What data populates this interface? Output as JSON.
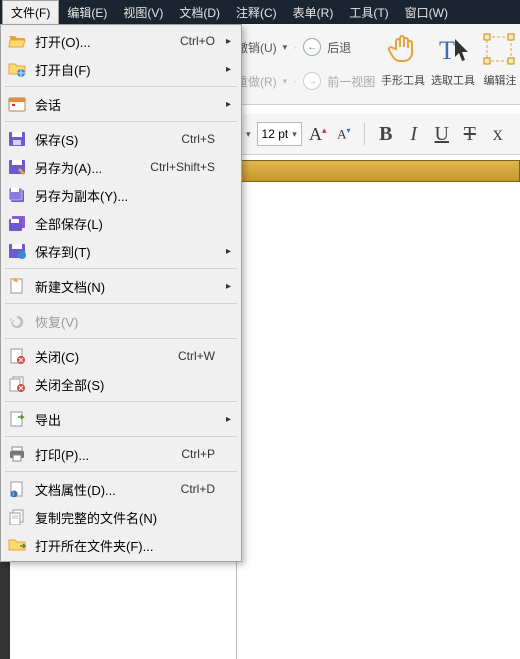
{
  "menubar": {
    "items": [
      {
        "label": "文件(F)",
        "active": true
      },
      {
        "label": "编辑(E)"
      },
      {
        "label": "视图(V)"
      },
      {
        "label": "文档(D)"
      },
      {
        "label": "注释(C)"
      },
      {
        "label": "表单(R)"
      },
      {
        "label": "工具(T)"
      },
      {
        "label": "窗口(W)"
      }
    ]
  },
  "ribbon": {
    "undo_label": "撤销(U)",
    "redo_label": "重做(R)",
    "back_label": "后退",
    "prev_view_label": "前一视图",
    "tools": [
      {
        "label": "手形工具"
      },
      {
        "label": "选取工具"
      },
      {
        "label": "编辑注"
      }
    ]
  },
  "toolbar2": {
    "font_size": "12 pt",
    "grow": "A",
    "shrink": "A",
    "bold": "B",
    "italic": "I",
    "underline": "U",
    "strike": "T"
  },
  "file_menu": {
    "items": [
      {
        "icon": "folder-open-icon",
        "label": "打开(O)...",
        "shortcut": "Ctrl+O",
        "sub": true
      },
      {
        "icon": "folder-globe-icon",
        "label": "打开自(F)",
        "sub": true
      },
      {
        "sep": true
      },
      {
        "icon": "calendar-icon",
        "label": "会话",
        "sub": true
      },
      {
        "sep": true
      },
      {
        "icon": "save-icon",
        "label": "保存(S)",
        "shortcut": "Ctrl+S"
      },
      {
        "icon": "save-as-icon",
        "label": "另存为(A)...",
        "shortcut": "Ctrl+Shift+S"
      },
      {
        "icon": "save-copy-icon",
        "label": "另存为副本(Y)..."
      },
      {
        "icon": "save-all-icon",
        "label": "全部保存(L)"
      },
      {
        "icon": "save-to-icon",
        "label": "保存到(T)",
        "sub": true
      },
      {
        "sep": true
      },
      {
        "icon": "new-doc-icon",
        "label": "新建文档(N)",
        "sub": true
      },
      {
        "sep": true
      },
      {
        "icon": "revert-icon",
        "label": "恢复(V)",
        "disabled": true
      },
      {
        "sep": true
      },
      {
        "icon": "close-doc-icon",
        "label": "关闭(C)",
        "shortcut": "Ctrl+W"
      },
      {
        "icon": "close-all-icon",
        "label": "关闭全部(S)"
      },
      {
        "sep": true
      },
      {
        "icon": "export-icon",
        "label": "导出",
        "sub": true
      },
      {
        "sep": true
      },
      {
        "icon": "print-icon",
        "label": "打印(P)...",
        "shortcut": "Ctrl+P"
      },
      {
        "sep": true
      },
      {
        "icon": "properties-icon",
        "label": "文档属性(D)...",
        "shortcut": "Ctrl+D"
      },
      {
        "icon": "copy-name-icon",
        "label": "复制完整的文件名(N)"
      },
      {
        "icon": "open-folder-icon",
        "label": "打开所在文件夹(F)..."
      }
    ]
  }
}
